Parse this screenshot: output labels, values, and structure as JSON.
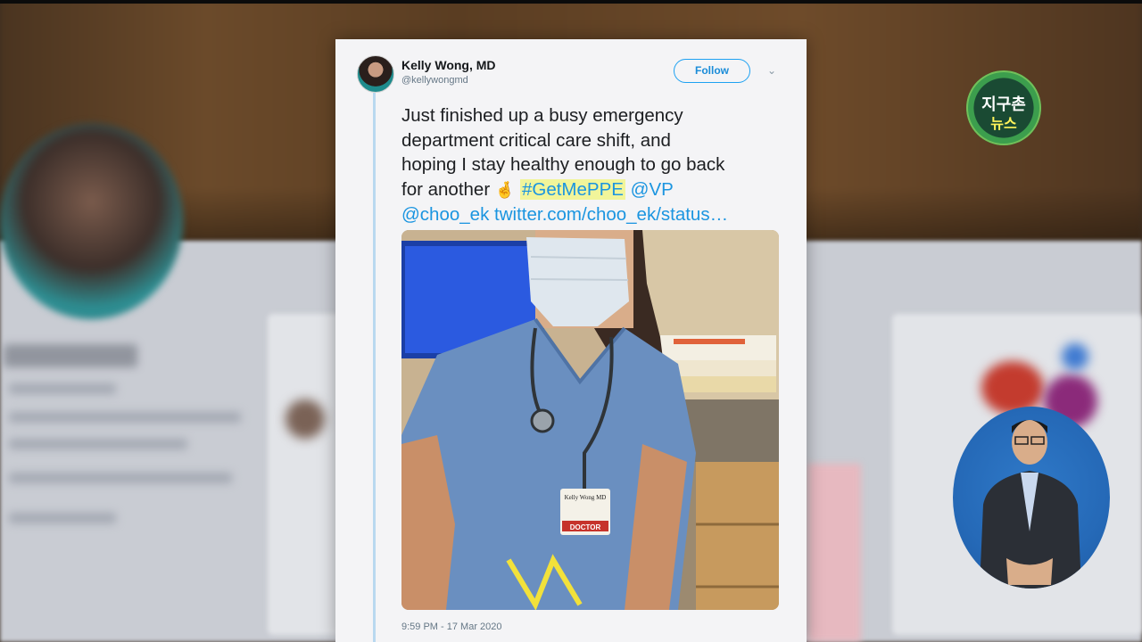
{
  "tweet": {
    "author_name": "Kelly Wong, MD",
    "author_handle": "@kellywongmd",
    "follow_label": "Follow",
    "text_line1": "Just finished up a busy emergency",
    "text_line2": "department critical care shift, and",
    "text_line3": "hoping I stay healthy enough to go back",
    "text_line4_start": "for another",
    "text_emoji": "🤞",
    "hashtag": "#GetMePPE",
    "mention_vp": "@VP",
    "mention_choo": "@choo_ek",
    "link": "twitter.com/choo_ek/status…",
    "badge_name": "Kelly Wong MD",
    "badge_role": "DOCTOR",
    "timestamp": "9:59 PM - 17 Mar 2020"
  },
  "news_logo": {
    "line1": "지구촌",
    "line2": "뉴스"
  },
  "icons": {
    "caret": "chevron-down-icon",
    "avatar": "profile-avatar",
    "emoji": "crossed-fingers-emoji"
  },
  "colors": {
    "follow_blue": "#1da1f2",
    "link_blue": "#1b95e0",
    "hashtag_highlight": "#f1f59a",
    "logo_green": "#3c9e4d",
    "interpreter_bg": "#2569b7"
  }
}
